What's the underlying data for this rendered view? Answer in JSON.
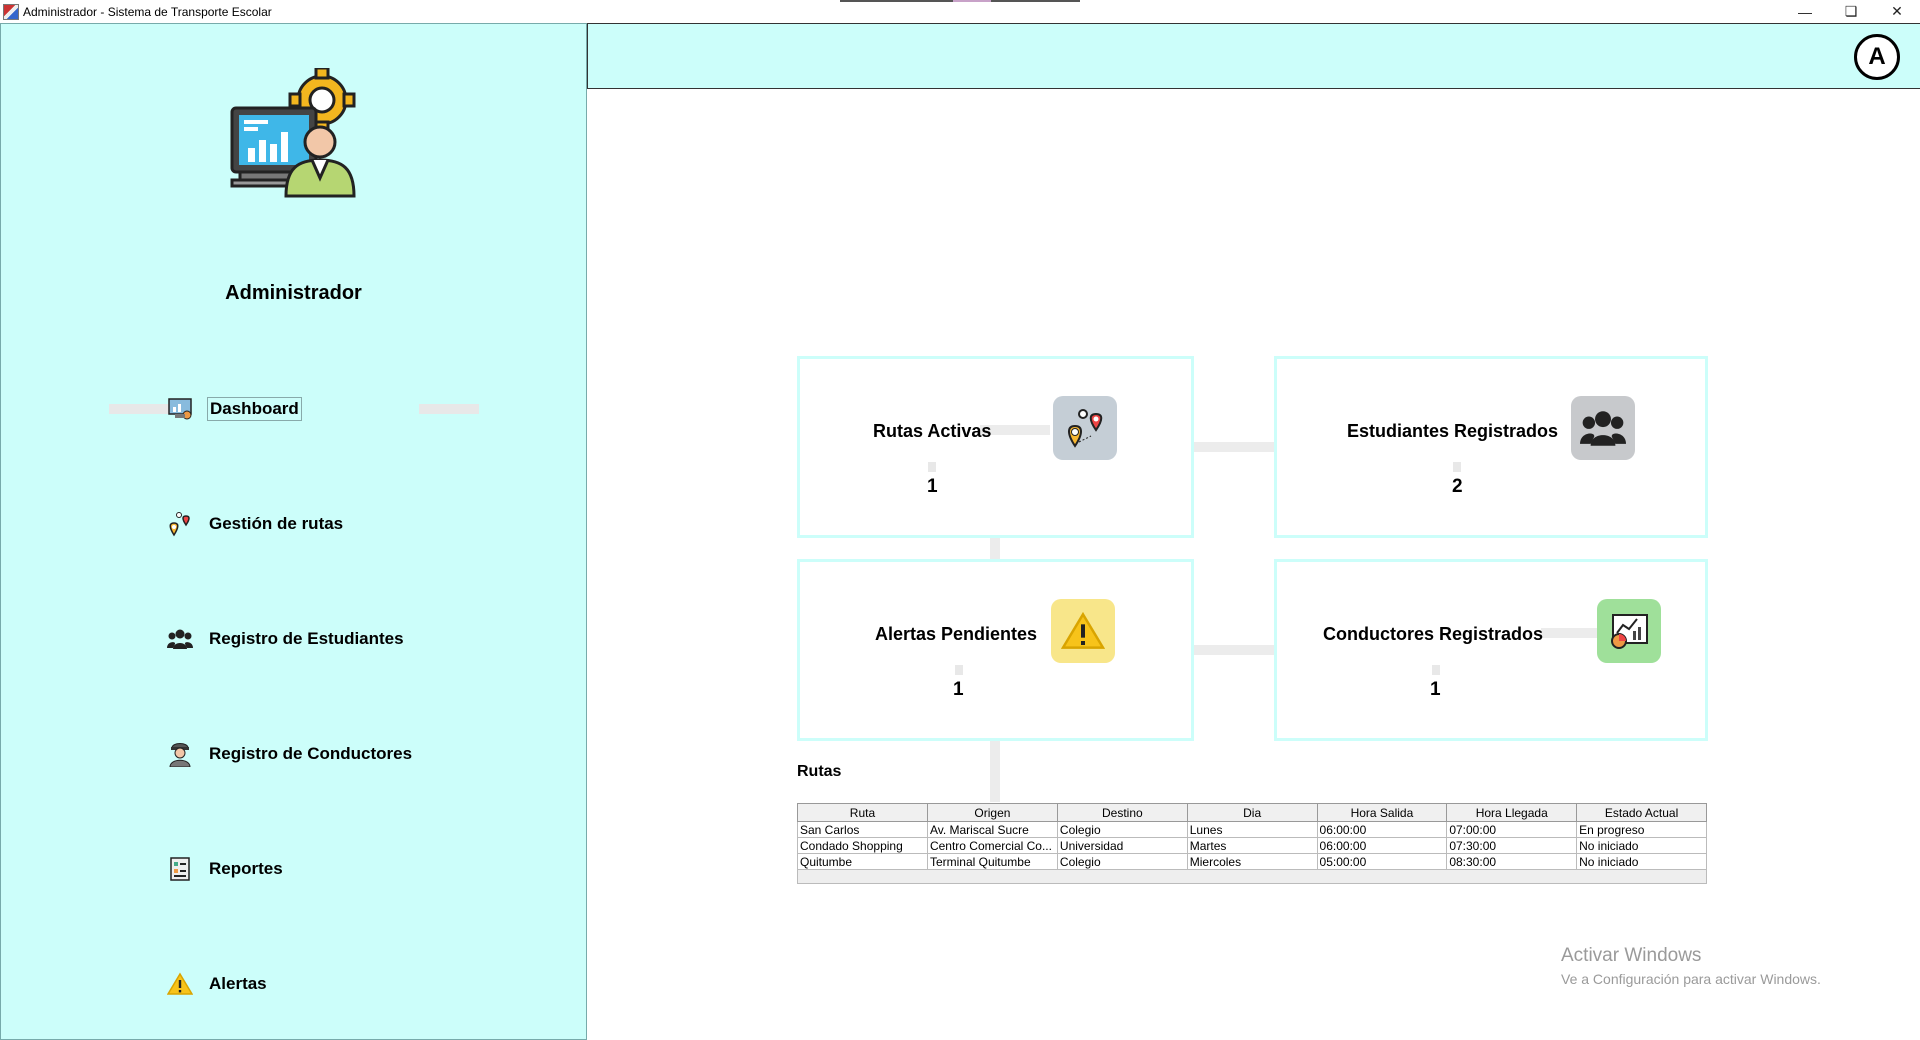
{
  "window": {
    "title": "Administrador - Sistema de Transporte Escolar",
    "controls": [
      "minimize-icon",
      "restore-icon",
      "close-icon"
    ]
  },
  "sidebar": {
    "role": "Administrador",
    "items": [
      {
        "label": "Dashboard",
        "icon": "dashboard-icon",
        "active": true
      },
      {
        "label": "Gestión de rutas",
        "icon": "route-pins-icon"
      },
      {
        "label": "Registro de Estudiantes",
        "icon": "group-icon"
      },
      {
        "label": "Registro de Conductores",
        "icon": "driver-icon"
      },
      {
        "label": "Reportes",
        "icon": "report-icon"
      },
      {
        "label": "Alertas",
        "icon": "warning-icon"
      }
    ]
  },
  "header": {
    "avatar_label": "A"
  },
  "cards": {
    "rutas": {
      "title": "Rutas Activas",
      "value": "1",
      "icon": "route-pins-icon",
      "icon_bg": "#c5ced6"
    },
    "estudiantes": {
      "title": "Estudiantes Registrados",
      "value": "2",
      "icon": "group-icon",
      "icon_bg": "#c7c9cc"
    },
    "alertas": {
      "title": "Alertas Pendientes",
      "value": "1",
      "icon": "warning-icon",
      "icon_bg": "#f8e68a"
    },
    "conductores": {
      "title": "Conductores Registrados",
      "value": "1",
      "icon": "chart-report-icon",
      "icon_bg": "#9fe09a"
    }
  },
  "rutas_table": {
    "title": "Rutas",
    "columns": [
      "Ruta",
      "Origen",
      "Destino",
      "Dia",
      "Hora Salida",
      "Hora Llegada",
      "Estado Actual"
    ],
    "rows": [
      [
        "San Carlos",
        "Av. Mariscal Sucre",
        "Colegio",
        "Lunes",
        "06:00:00",
        "07:00:00",
        "En progreso"
      ],
      [
        "Condado Shopping",
        "Centro Comercial Co...",
        "Universidad",
        "Martes",
        "06:00:00",
        "07:30:00",
        "No iniciado"
      ],
      [
        "Quitumbe",
        "Terminal Quitumbe",
        "Colegio",
        "Miercoles",
        "05:00:00",
        "08:30:00",
        "No iniciado"
      ]
    ]
  },
  "watermark": {
    "line1": "Activar Windows",
    "line2": "Ve a Configuración para activar Windows."
  },
  "colors": {
    "accent": "#ccfefa"
  }
}
